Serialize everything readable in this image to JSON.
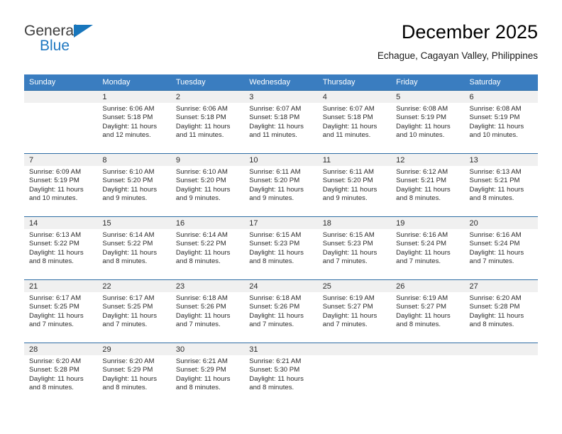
{
  "brand": {
    "word_general": "General",
    "word_blue": "Blue",
    "triangle_color": "#1876bc",
    "blue_color": "#1f78c1"
  },
  "header": {
    "title": "December 2025",
    "subtitle": "Echague, Cagayan Valley, Philippines"
  },
  "theme": {
    "header_row_bg": "#3a7dc0",
    "daynum_band_bg": "#f0f0f0",
    "cell_border": "#2e6da4",
    "text": "#2b2b2b"
  },
  "weekday_headers": [
    "Sunday",
    "Monday",
    "Tuesday",
    "Wednesday",
    "Thursday",
    "Friday",
    "Saturday"
  ],
  "weeks": [
    [
      {
        "day": "",
        "sunrise": "",
        "sunset": "",
        "daylight1": "",
        "daylight2": "",
        "empty": true
      },
      {
        "day": "1",
        "sunrise": "Sunrise: 6:06 AM",
        "sunset": "Sunset: 5:18 PM",
        "daylight1": "Daylight: 11 hours",
        "daylight2": "and 12 minutes."
      },
      {
        "day": "2",
        "sunrise": "Sunrise: 6:06 AM",
        "sunset": "Sunset: 5:18 PM",
        "daylight1": "Daylight: 11 hours",
        "daylight2": "and 11 minutes."
      },
      {
        "day": "3",
        "sunrise": "Sunrise: 6:07 AM",
        "sunset": "Sunset: 5:18 PM",
        "daylight1": "Daylight: 11 hours",
        "daylight2": "and 11 minutes."
      },
      {
        "day": "4",
        "sunrise": "Sunrise: 6:07 AM",
        "sunset": "Sunset: 5:18 PM",
        "daylight1": "Daylight: 11 hours",
        "daylight2": "and 11 minutes."
      },
      {
        "day": "5",
        "sunrise": "Sunrise: 6:08 AM",
        "sunset": "Sunset: 5:19 PM",
        "daylight1": "Daylight: 11 hours",
        "daylight2": "and 10 minutes."
      },
      {
        "day": "6",
        "sunrise": "Sunrise: 6:08 AM",
        "sunset": "Sunset: 5:19 PM",
        "daylight1": "Daylight: 11 hours",
        "daylight2": "and 10 minutes."
      }
    ],
    [
      {
        "day": "7",
        "sunrise": "Sunrise: 6:09 AM",
        "sunset": "Sunset: 5:19 PM",
        "daylight1": "Daylight: 11 hours",
        "daylight2": "and 10 minutes."
      },
      {
        "day": "8",
        "sunrise": "Sunrise: 6:10 AM",
        "sunset": "Sunset: 5:20 PM",
        "daylight1": "Daylight: 11 hours",
        "daylight2": "and 9 minutes."
      },
      {
        "day": "9",
        "sunrise": "Sunrise: 6:10 AM",
        "sunset": "Sunset: 5:20 PM",
        "daylight1": "Daylight: 11 hours",
        "daylight2": "and 9 minutes."
      },
      {
        "day": "10",
        "sunrise": "Sunrise: 6:11 AM",
        "sunset": "Sunset: 5:20 PM",
        "daylight1": "Daylight: 11 hours",
        "daylight2": "and 9 minutes."
      },
      {
        "day": "11",
        "sunrise": "Sunrise: 6:11 AM",
        "sunset": "Sunset: 5:20 PM",
        "daylight1": "Daylight: 11 hours",
        "daylight2": "and 9 minutes."
      },
      {
        "day": "12",
        "sunrise": "Sunrise: 6:12 AM",
        "sunset": "Sunset: 5:21 PM",
        "daylight1": "Daylight: 11 hours",
        "daylight2": "and 8 minutes."
      },
      {
        "day": "13",
        "sunrise": "Sunrise: 6:13 AM",
        "sunset": "Sunset: 5:21 PM",
        "daylight1": "Daylight: 11 hours",
        "daylight2": "and 8 minutes."
      }
    ],
    [
      {
        "day": "14",
        "sunrise": "Sunrise: 6:13 AM",
        "sunset": "Sunset: 5:22 PM",
        "daylight1": "Daylight: 11 hours",
        "daylight2": "and 8 minutes."
      },
      {
        "day": "15",
        "sunrise": "Sunrise: 6:14 AM",
        "sunset": "Sunset: 5:22 PM",
        "daylight1": "Daylight: 11 hours",
        "daylight2": "and 8 minutes."
      },
      {
        "day": "16",
        "sunrise": "Sunrise: 6:14 AM",
        "sunset": "Sunset: 5:22 PM",
        "daylight1": "Daylight: 11 hours",
        "daylight2": "and 8 minutes."
      },
      {
        "day": "17",
        "sunrise": "Sunrise: 6:15 AM",
        "sunset": "Sunset: 5:23 PM",
        "daylight1": "Daylight: 11 hours",
        "daylight2": "and 8 minutes."
      },
      {
        "day": "18",
        "sunrise": "Sunrise: 6:15 AM",
        "sunset": "Sunset: 5:23 PM",
        "daylight1": "Daylight: 11 hours",
        "daylight2": "and 7 minutes."
      },
      {
        "day": "19",
        "sunrise": "Sunrise: 6:16 AM",
        "sunset": "Sunset: 5:24 PM",
        "daylight1": "Daylight: 11 hours",
        "daylight2": "and 7 minutes."
      },
      {
        "day": "20",
        "sunrise": "Sunrise: 6:16 AM",
        "sunset": "Sunset: 5:24 PM",
        "daylight1": "Daylight: 11 hours",
        "daylight2": "and 7 minutes."
      }
    ],
    [
      {
        "day": "21",
        "sunrise": "Sunrise: 6:17 AM",
        "sunset": "Sunset: 5:25 PM",
        "daylight1": "Daylight: 11 hours",
        "daylight2": "and 7 minutes."
      },
      {
        "day": "22",
        "sunrise": "Sunrise: 6:17 AM",
        "sunset": "Sunset: 5:25 PM",
        "daylight1": "Daylight: 11 hours",
        "daylight2": "and 7 minutes."
      },
      {
        "day": "23",
        "sunrise": "Sunrise: 6:18 AM",
        "sunset": "Sunset: 5:26 PM",
        "daylight1": "Daylight: 11 hours",
        "daylight2": "and 7 minutes."
      },
      {
        "day": "24",
        "sunrise": "Sunrise: 6:18 AM",
        "sunset": "Sunset: 5:26 PM",
        "daylight1": "Daylight: 11 hours",
        "daylight2": "and 7 minutes."
      },
      {
        "day": "25",
        "sunrise": "Sunrise: 6:19 AM",
        "sunset": "Sunset: 5:27 PM",
        "daylight1": "Daylight: 11 hours",
        "daylight2": "and 7 minutes."
      },
      {
        "day": "26",
        "sunrise": "Sunrise: 6:19 AM",
        "sunset": "Sunset: 5:27 PM",
        "daylight1": "Daylight: 11 hours",
        "daylight2": "and 8 minutes."
      },
      {
        "day": "27",
        "sunrise": "Sunrise: 6:20 AM",
        "sunset": "Sunset: 5:28 PM",
        "daylight1": "Daylight: 11 hours",
        "daylight2": "and 8 minutes."
      }
    ],
    [
      {
        "day": "28",
        "sunrise": "Sunrise: 6:20 AM",
        "sunset": "Sunset: 5:28 PM",
        "daylight1": "Daylight: 11 hours",
        "daylight2": "and 8 minutes."
      },
      {
        "day": "29",
        "sunrise": "Sunrise: 6:20 AM",
        "sunset": "Sunset: 5:29 PM",
        "daylight1": "Daylight: 11 hours",
        "daylight2": "and 8 minutes."
      },
      {
        "day": "30",
        "sunrise": "Sunrise: 6:21 AM",
        "sunset": "Sunset: 5:29 PM",
        "daylight1": "Daylight: 11 hours",
        "daylight2": "and 8 minutes."
      },
      {
        "day": "31",
        "sunrise": "Sunrise: 6:21 AM",
        "sunset": "Sunset: 5:30 PM",
        "daylight1": "Daylight: 11 hours",
        "daylight2": "and 8 minutes."
      },
      {
        "day": "",
        "sunrise": "",
        "sunset": "",
        "daylight1": "",
        "daylight2": "",
        "empty": true
      },
      {
        "day": "",
        "sunrise": "",
        "sunset": "",
        "daylight1": "",
        "daylight2": "",
        "empty": true
      },
      {
        "day": "",
        "sunrise": "",
        "sunset": "",
        "daylight1": "",
        "daylight2": "",
        "empty": true
      }
    ]
  ]
}
